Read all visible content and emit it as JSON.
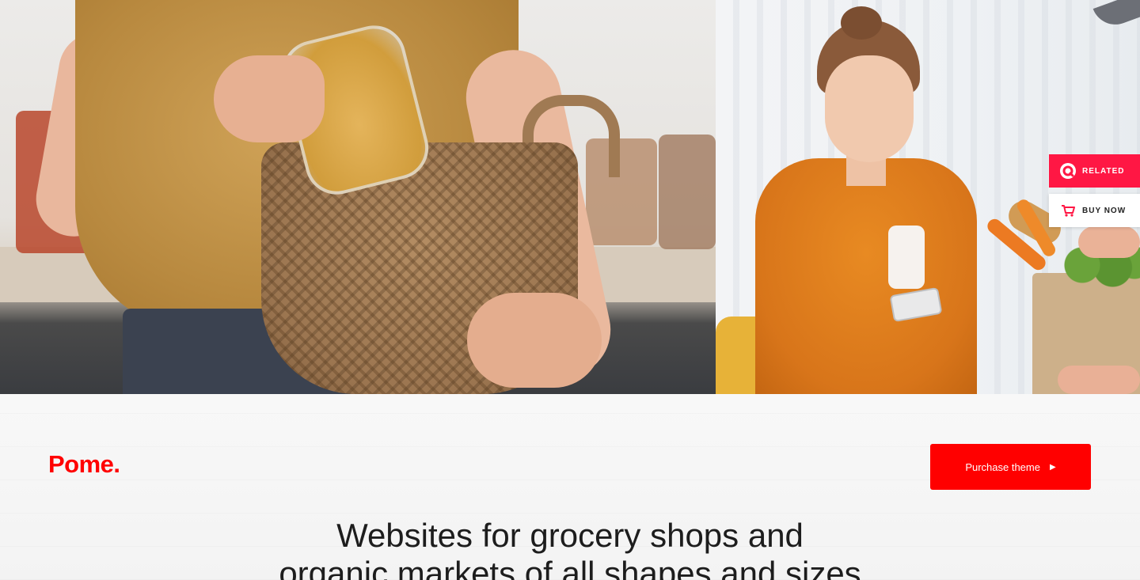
{
  "side_buttons": {
    "related": {
      "label": "RELATED",
      "icon": "related-ring-icon"
    },
    "buy_now": {
      "label": "BUY NOW",
      "icon": "cart-icon"
    }
  },
  "brand": {
    "logo_text": "Pome."
  },
  "header": {
    "purchase_label": "Purchase theme",
    "purchase_icon": "caret-right-icon"
  },
  "hero": {
    "heading_line1": "Websites for grocery shops and",
    "heading_line2": "organic markets of all shapes and sizes"
  },
  "colors": {
    "accent": "#ff0000",
    "related_bg": "#ff1744",
    "text_dark": "#1d1d1d"
  }
}
